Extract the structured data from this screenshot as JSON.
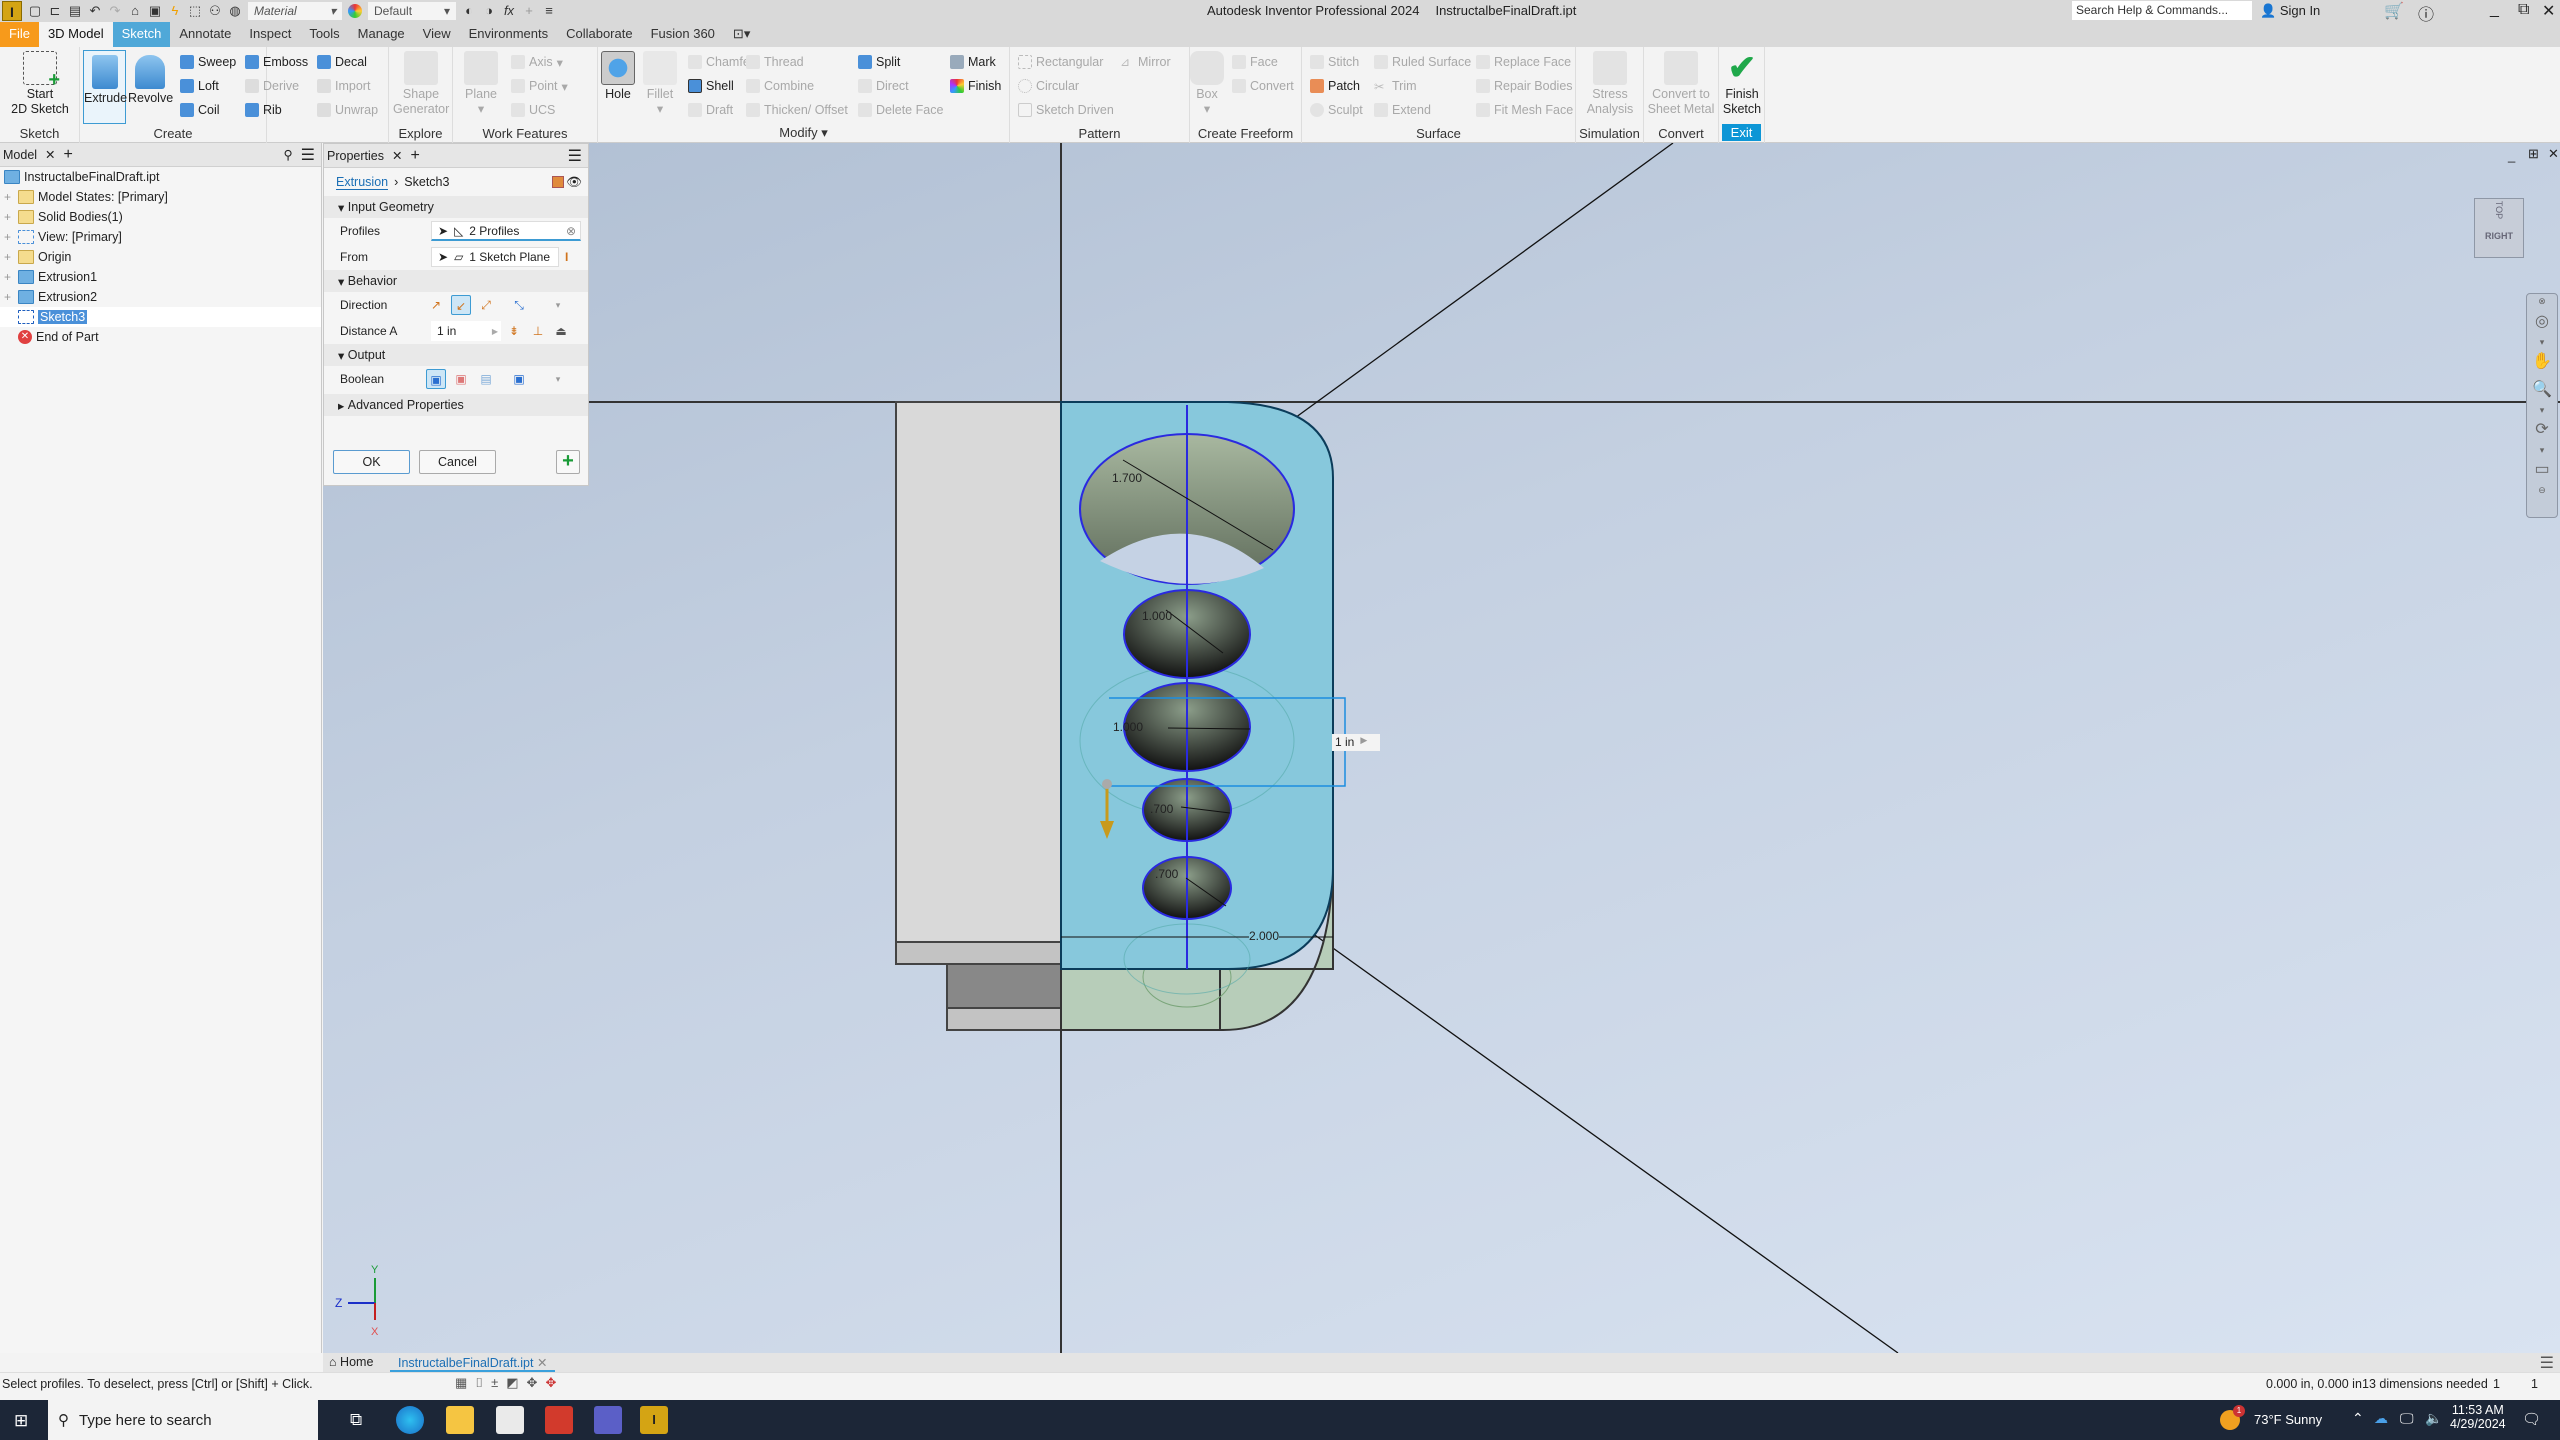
{
  "titlebar": {
    "material_placeholder": "Material",
    "appearance_value": "Default",
    "app_name": "Autodesk Inventor Professional 2024",
    "document_name": "InstructalbeFinalDraft.ipt",
    "search_placeholder": "Search Help & Commands...",
    "sign_in": "Sign In"
  },
  "tabs": [
    "File",
    "3D Model",
    "Sketch",
    "Annotate",
    "Inspect",
    "Tools",
    "Manage",
    "View",
    "Environments",
    "Collaborate",
    "Fusion 360"
  ],
  "ribbon": {
    "sketch": {
      "title": "Sketch",
      "start_line1": "Start",
      "start_line2": "2D Sketch"
    },
    "create": {
      "title": "Create",
      "extrude": "Extrude",
      "revolve": "Revolve",
      "sweep": "Sweep",
      "loft": "Loft",
      "coil": "Coil",
      "emboss": "Emboss",
      "derive": "Derive",
      "rib": "Rib",
      "decal": "Decal",
      "import": "Import",
      "unwrap": "Unwrap"
    },
    "explore": {
      "title": "Explore",
      "shape1": "Shape",
      "shape2": "Generator"
    },
    "work_features": {
      "title": "Work Features",
      "plane": "Plane",
      "axis": "Axis",
      "point": "Point",
      "ucs": "UCS"
    },
    "modify": {
      "title": "Modify",
      "hole": "Hole",
      "fillet": "Fillet",
      "chamfer": "Chamfer",
      "shell": "Shell",
      "draft": "Draft",
      "thread": "Thread",
      "combine": "Combine",
      "thicken": "Thicken/ Offset",
      "split": "Split",
      "direct": "Direct",
      "delete_face": "Delete Face",
      "mark": "Mark",
      "finish": "Finish"
    },
    "pattern": {
      "title": "Pattern",
      "rectangular": "Rectangular",
      "circular": "Circular",
      "sketch_driven": "Sketch Driven",
      "mirror": "Mirror"
    },
    "freeform": {
      "title": "Create Freeform",
      "box": "Box",
      "face": "Face",
      "convert": "Convert"
    },
    "surface": {
      "title": "Surface",
      "stitch": "Stitch",
      "patch": "Patch",
      "sculpt": "Sculpt",
      "ruled": "Ruled Surface",
      "trim": "Trim",
      "extend": "Extend",
      "replace": "Replace Face",
      "repair": "Repair Bodies",
      "fitmesh": "Fit Mesh Face"
    },
    "simulation": {
      "title": "Simulation",
      "l1": "Stress",
      "l2": "Analysis"
    },
    "convert": {
      "title": "Convert",
      "l1": "Convert to",
      "l2": "Sheet Metal"
    },
    "exit": {
      "title": "Exit",
      "l1": "Finish",
      "l2": "Sketch"
    }
  },
  "model_browser": {
    "tab": "Model",
    "items": [
      {
        "label": "InstructalbeFinalDraft.ipt"
      },
      {
        "label": "Model States: [Primary]"
      },
      {
        "label": "Solid Bodies(1)"
      },
      {
        "label": "View: [Primary]"
      },
      {
        "label": "Origin"
      },
      {
        "label": "Extrusion1"
      },
      {
        "label": "Extrusion2"
      },
      {
        "label": "Sketch3"
      },
      {
        "label": "End of Part"
      }
    ]
  },
  "properties": {
    "tab": "Properties",
    "breadcrumb_feature": "Extrusion",
    "breadcrumb_sketch": "Sketch3",
    "input_geometry": "Input Geometry",
    "profiles_label": "Profiles",
    "profiles_value": "2 Profiles",
    "from_label": "From",
    "from_value": "1 Sketch Plane",
    "behavior": "Behavior",
    "direction_label": "Direction",
    "distance_label": "Distance A",
    "distance_value": "1 in",
    "output": "Output",
    "boolean_label": "Boolean",
    "advanced": "Advanced Properties",
    "ok": "OK",
    "cancel": "Cancel"
  },
  "viewport": {
    "dims": {
      "d1": "1.700",
      "d2": "1.000",
      "d3": "1.000",
      "d4": ".700",
      "d5": ".700",
      "d6": "2.000"
    },
    "distance_input": "1 in",
    "viewcube_face": "RIGHT",
    "viewcube_top": "TOP",
    "axis_y": "Y",
    "axis_z": "Z",
    "axis_x": "X"
  },
  "docbar": {
    "home": "Home",
    "doc_tab": "InstructalbeFinalDraft.ipt"
  },
  "statusbar": {
    "hint": "Select profiles. To deselect, press [Ctrl] or [Shift] + Click.",
    "coords": "0.000 in, 0.000 in",
    "dims_needed": "13 dimensions needed",
    "n1": "1",
    "n2": "1"
  },
  "taskbar": {
    "search_placeholder": "Type here to search",
    "weather": "73°F  Sunny",
    "weather_badge": "1",
    "time": "11:53 AM",
    "date": "4/29/2024"
  },
  "colors": {
    "accent": "#0d96d6",
    "file_tab": "#f79a1b",
    "sketch_tab": "#4fa8d8",
    "profile_fill": "#87c8dc",
    "sketch_line": "#1f2fe0"
  }
}
